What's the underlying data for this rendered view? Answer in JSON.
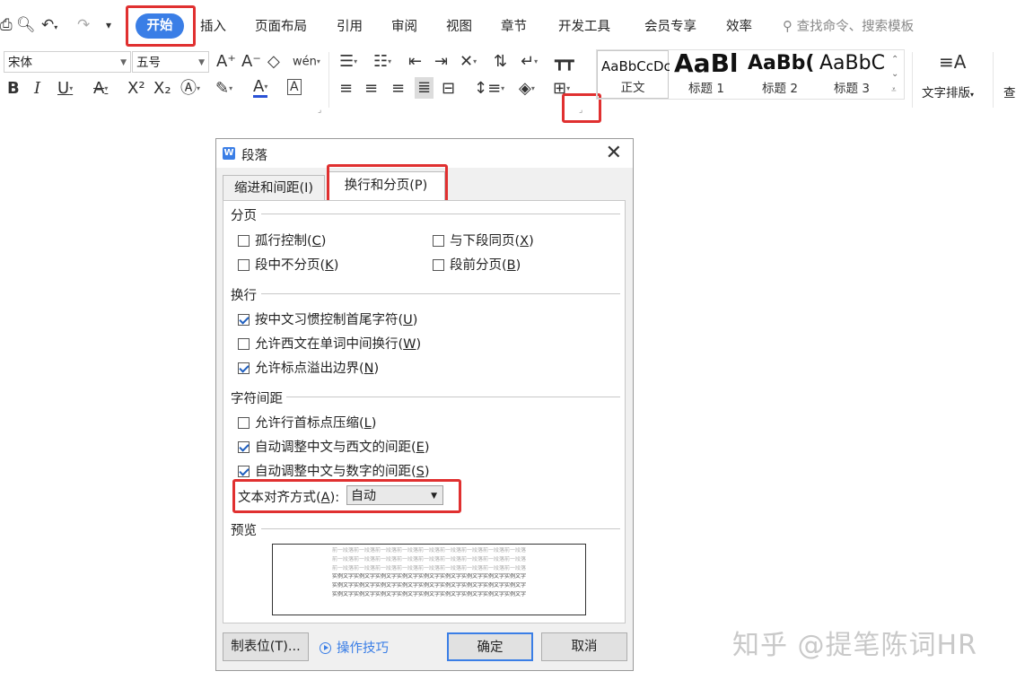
{
  "menubar": {
    "active_tab": "开始",
    "tabs": [
      "插入",
      "页面布局",
      "引用",
      "审阅",
      "视图",
      "章节",
      "开发工具",
      "会员专享",
      "效率"
    ],
    "search_placeholder": "查找命令、搜索模板"
  },
  "ribbon": {
    "font_name": "宋体",
    "font_size": "五号",
    "styles": [
      {
        "preview": "AaBbCcDc",
        "label": "正文"
      },
      {
        "preview": "AaBl",
        "label": "标题 1"
      },
      {
        "preview": "AaBb(",
        "label": "标题 2"
      },
      {
        "preview": "AaBbC",
        "label": "标题 3"
      }
    ],
    "text_layout_label": "文字排版",
    "find_label": "查"
  },
  "dialog": {
    "title": "段落",
    "tabs": [
      "缩进和间距(I)",
      "换行和分页(P)"
    ],
    "active_tab_index": 1,
    "sections": {
      "pagination": {
        "title": "分页",
        "options": [
          {
            "label": "孤行控制(",
            "key": "C",
            "checked": false
          },
          {
            "label": "与下段同页(",
            "key": "X",
            "checked": false
          },
          {
            "label": "段中不分页(",
            "key": "K",
            "checked": false
          },
          {
            "label": "段前分页(",
            "key": "B",
            "checked": false
          }
        ]
      },
      "line_break": {
        "title": "换行",
        "options": [
          {
            "label": "按中文习惯控制首尾字符(",
            "key": "U",
            "checked": true
          },
          {
            "label": "允许西文在单词中间换行(",
            "key": "W",
            "checked": false
          },
          {
            "label": "允许标点溢出边界(",
            "key": "N",
            "checked": true
          }
        ]
      },
      "char_spacing": {
        "title": "字符间距",
        "options": [
          {
            "label": "允许行首标点压缩(",
            "key": "L",
            "checked": false
          },
          {
            "label": "自动调整中文与西文的间距(",
            "key": "E",
            "checked": true
          },
          {
            "label": "自动调整中文与数字的间距(",
            "key": "S",
            "checked": true
          }
        ],
        "text_align_label": "文本对齐方式(",
        "text_align_key": "A",
        "text_align_value": "自动"
      },
      "preview": {
        "title": "预览",
        "prev_para_text": "前一段落前一段落前一段落前一段落前一段落前一段落前一段落前一段落前一段落",
        "sample_text": "实例文字实例文字实例文字实例文字实例文字实例文字实例文字实例文字实例文字"
      }
    },
    "tabs_button": "制表位(T)...",
    "tips_link": "操作技巧",
    "ok_button": "确定",
    "cancel_button": "取消"
  },
  "watermark": "知乎 @提笔陈词HR",
  "colors": {
    "accent": "#3a7ee6",
    "highlight_box": "#e03030"
  }
}
